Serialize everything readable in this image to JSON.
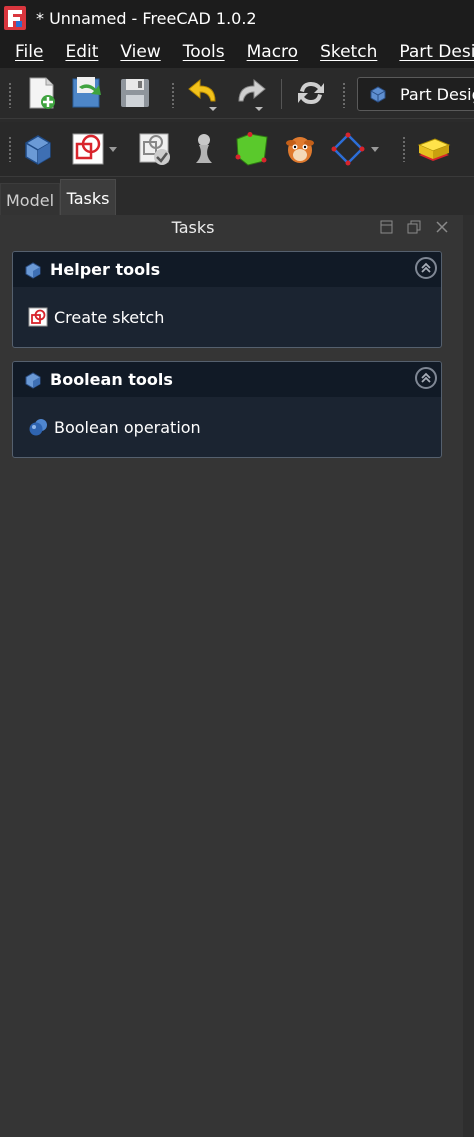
{
  "window": {
    "title": "* Unnamed - FreeCAD 1.0.2",
    "logo": "freecad-logo-icon"
  },
  "menu": [
    "File",
    "Edit",
    "View",
    "Tools",
    "Macro",
    "Sketch",
    "Part Design"
  ],
  "toolbar_file": {
    "icons": [
      "new-document-icon",
      "open-document-icon",
      "save-document-icon",
      "undo-icon",
      "redo-icon",
      "refresh-icon"
    ],
    "workbench_selector": {
      "label": "Part Design",
      "icon": "part-design-icon"
    }
  },
  "toolbar_partdesign": {
    "icons": [
      "body-icon",
      "sketch-icon",
      "validate-sketch-icon",
      "shape-binder-icon",
      "subshape-binder-icon",
      "clone-icon",
      "datum-plane-icon",
      "pad-icon"
    ]
  },
  "tabs": [
    {
      "label": "Model",
      "active": false
    },
    {
      "label": "Tasks",
      "active": true
    }
  ],
  "tasks_panel": {
    "title": "Tasks",
    "boxes": [
      {
        "title": "Helper tools",
        "action": "Create sketch",
        "action_icon": "sketch-icon"
      },
      {
        "title": "Boolean tools",
        "action": "Boolean operation",
        "action_icon": "boolean-icon"
      }
    ]
  },
  "colors": {
    "taskbox_bg": "#1b2431",
    "taskbox_header": "#111a26",
    "panel_bg": "#353535",
    "logo_red": "#d9363e"
  }
}
